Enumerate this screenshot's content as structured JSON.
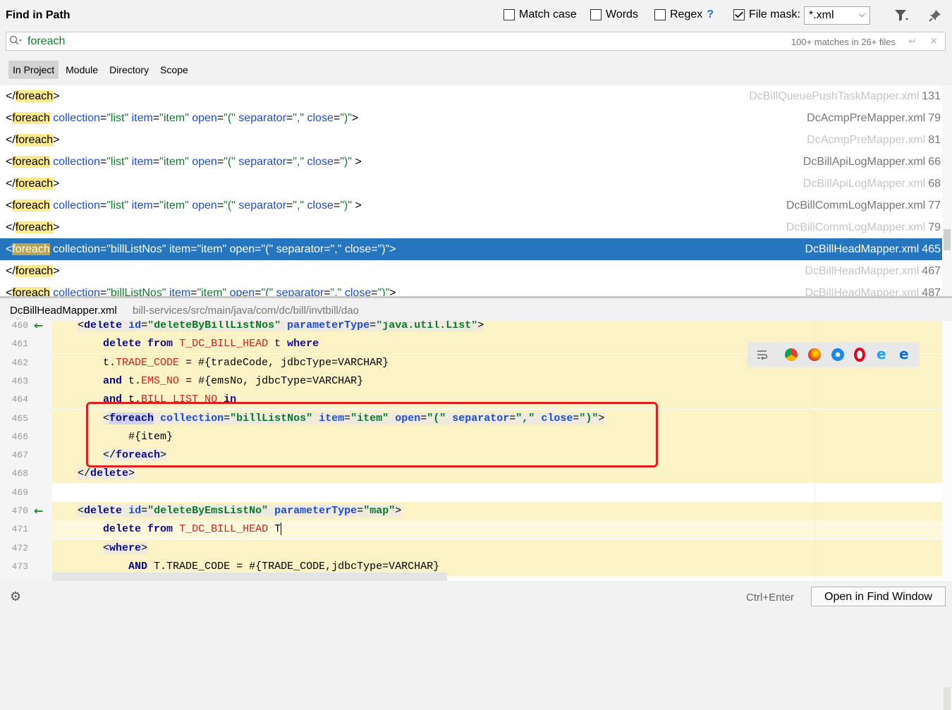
{
  "header": {
    "title": "Find in Path",
    "match_case": {
      "label": "Match case",
      "checked": false
    },
    "words": {
      "label": "Words",
      "checked": false
    },
    "regex": {
      "label": "Regex",
      "checked": false,
      "help": "?"
    },
    "file_mask": {
      "label": "File mask:",
      "checked": true,
      "value": "*.xml"
    },
    "filter_icon": "filter-icon",
    "pin_icon": "pin-icon"
  },
  "search": {
    "value": "foreach",
    "count": "100+ matches in 26+ files",
    "icon": "search-icon"
  },
  "scopes": [
    "In Project",
    "Module",
    "Directory",
    "Scope"
  ],
  "active_scope": "In Project",
  "results": [
    {
      "open": "</",
      "match": "foreach",
      "attrs": [],
      "tail": ">",
      "file": "DcBillQueuePushTaskMapper.xml",
      "line": "131",
      "dim": true
    },
    {
      "open": "<",
      "match": "foreach",
      "attrs": [
        [
          "collection",
          "\"list\""
        ],
        [
          "item",
          "\"item\""
        ],
        [
          "open",
          "\"(\""
        ],
        [
          "separator",
          "\",\""
        ],
        [
          "close",
          "\")\""
        ]
      ],
      "tail": ">",
      "file": "DcAcmpPreMapper.xml",
      "line": "79",
      "dim": false
    },
    {
      "open": "</",
      "match": "foreach",
      "attrs": [],
      "tail": ">",
      "file": "DcAcmpPreMapper.xml",
      "line": "81",
      "dim": true
    },
    {
      "open": "<",
      "match": "foreach",
      "attrs": [
        [
          "collection",
          "\"list\""
        ],
        [
          "item",
          "\"item\""
        ],
        [
          "open",
          "\"(\""
        ],
        [
          "separator",
          "\",\""
        ],
        [
          "close",
          "\")\""
        ]
      ],
      "tail": "  >",
      "file": "DcBillApiLogMapper.xml",
      "line": "66",
      "dim": false
    },
    {
      "open": "</",
      "match": "foreach",
      "attrs": [],
      "tail": ">",
      "file": "DcBillApiLogMapper.xml",
      "line": "68",
      "dim": true
    },
    {
      "open": "<",
      "match": "foreach",
      "attrs": [
        [
          "collection",
          "\"list\""
        ],
        [
          "item",
          "\"item\""
        ],
        [
          "open",
          "\"(\""
        ],
        [
          "separator",
          "\",\""
        ],
        [
          "close",
          "\")\""
        ]
      ],
      "tail": "  >",
      "file": "DcBillCommLogMapper.xml",
      "line": "77",
      "dim": false
    },
    {
      "open": "</",
      "match": "foreach",
      "attrs": [],
      "tail": ">",
      "file": "DcBillCommLogMapper.xml",
      "line": "79",
      "dim": true
    },
    {
      "open": "<",
      "match": "foreach",
      "attrs": [
        [
          "collection",
          "\"billListNos\""
        ],
        [
          "item",
          "\"item\""
        ],
        [
          "open",
          "\"(\""
        ],
        [
          "separator",
          "\",\""
        ],
        [
          "close",
          "\")\""
        ]
      ],
      "tail": ">",
      "file": "DcBillHeadMapper.xml",
      "line": "465",
      "dim": false,
      "selected": true
    },
    {
      "open": "</",
      "match": "foreach",
      "attrs": [],
      "tail": ">",
      "file": "DcBillHeadMapper.xml",
      "line": "467",
      "dim": true
    },
    {
      "open": "<",
      "match": "foreach",
      "attrs": [
        [
          "collection",
          "\"billListNos\""
        ],
        [
          "item",
          "\"item\""
        ],
        [
          "open",
          "\"(\""
        ],
        [
          "separator",
          "\",\""
        ],
        [
          "close",
          "\")\""
        ]
      ],
      "tail": ">",
      "file": "DcBillHeadMapper.xml",
      "line": "487",
      "dim": true
    }
  ],
  "preview": {
    "file": "DcBillHeadMapper.xml",
    "path": "bill-services/src/main/java/com/dc/bill/invtbill/dao"
  },
  "editor_lines": [
    {
      "n": "460",
      "arrow": true,
      "band": true,
      "html": "    <span class='tagbg'>&lt;<span class='kw'>delete</span> <span class='ea'>id</span>=<span class='ev'>\"deleteByBillListNos\"</span> <span class='ea'>parameterType</span>=<span class='ev'>\"java.util.List\"</span>&gt;</span>"
    },
    {
      "n": "461",
      "band": true,
      "html": "        <span class='kw'>delete from</span> <span class='cn'>T_DC_BILL_HEAD</span> t <span class='kw'>where</span>"
    },
    {
      "n": "462",
      "band": true,
      "html": "        t.<span class='cn'>TRADE_CODE</span> = #{tradeCode, jdbcType=VARCHAR}"
    },
    {
      "n": "463",
      "band": true,
      "html": "        <span class='kw'>and</span> t.<span class='cn'>EMS_NO</span> = #{emsNo, jdbcType=VARCHAR}"
    },
    {
      "n": "464",
      "band": true,
      "html": "        <span class='kw'>and</span> t.<span class='cn'>BILL_LIST_NO</span> <span class='kw'>in</span>"
    },
    {
      "n": "465",
      "band": true,
      "html": "        <span class='tagbg'>&lt;<span class='kw fhl'>foreach</span> <span class='ea'>collection</span>=<span class='ev'>\"billListNos\"</span> <span class='ea'>item</span>=<span class='ev'>\"item\"</span> <span class='ea'>open</span>=<span class='ev'>\"(\"</span> <span class='ea'>separator</span>=<span class='ev'>\",\"</span> <span class='ea'>close</span>=<span class='ev'>\")\"</span>&gt;</span>"
    },
    {
      "n": "466",
      "band": true,
      "html": "            #{item}"
    },
    {
      "n": "467",
      "band": true,
      "html": "        <span class='tagbg'>&lt;/<span class='kw'>foreach</span>&gt;</span>"
    },
    {
      "n": "468",
      "band": true,
      "html": "    <span class='tagbg'>&lt;/<span class='kw'>delete</span>&gt;</span>"
    },
    {
      "n": "469",
      "band": false,
      "html": ""
    },
    {
      "n": "470",
      "arrow": true,
      "band": true,
      "html": "    <span class='tagbg'>&lt;<span class='kw'>delete</span> <span class='ea'>id</span>=<span class='ev'>\"deleteByEmsListNo\"</span> <span class='ea'>parameterType</span>=<span class='ev'>\"map\"</span>&gt;</span>"
    },
    {
      "n": "471",
      "band": true,
      "current": true,
      "html": "        <span class='kw'>delete from</span> <span class='cn'>T_DC_BILL_HEAD</span> T<span class='caret'></span>"
    },
    {
      "n": "472",
      "band": true,
      "html": "        <span class='tagbg'>&lt;<span class='kw'>where</span>&gt;</span>"
    },
    {
      "n": "473",
      "band": true,
      "html": "            <span class='kw'>AND</span> T.TRADE_CODE = #{TRADE_CODE,jdbcType=VARCHAR}"
    }
  ],
  "footer": {
    "hint": "Ctrl+Enter",
    "open_button": "Open in Find Window",
    "settings_icon": "gear-icon"
  },
  "colors": {
    "selection": "#2675bf",
    "match_highlight": "#fbe98f",
    "red_box": "#e02020"
  }
}
